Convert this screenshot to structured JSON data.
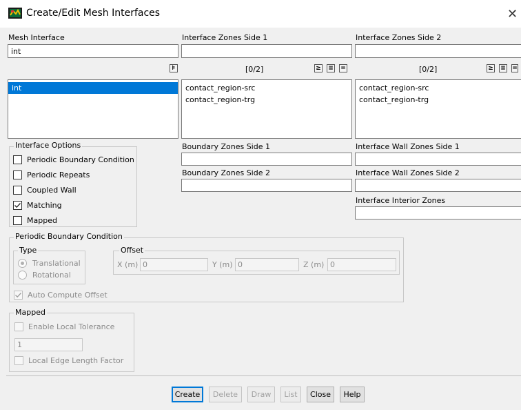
{
  "window": {
    "title": "Create/Edit Mesh Interfaces",
    "close_glyph": "✕"
  },
  "mesh_interface": {
    "label": "Mesh Interface",
    "value": "int",
    "items": [
      {
        "label": "int",
        "selected": true
      }
    ]
  },
  "zones_side1": {
    "label": "Interface Zones Side 1",
    "count": "[0/2]",
    "items": [
      "contact_region-src",
      "contact_region-trg"
    ]
  },
  "zones_side2": {
    "label": "Interface Zones Side 2",
    "count": "[0/2]",
    "items": [
      "contact_region-src",
      "contact_region-trg"
    ]
  },
  "interface_options": {
    "title": "Interface Options",
    "items": [
      {
        "label": "Periodic Boundary Condition",
        "checked": false
      },
      {
        "label": "Periodic Repeats",
        "checked": false
      },
      {
        "label": "Coupled Wall",
        "checked": false
      },
      {
        "label": "Matching",
        "checked": true
      },
      {
        "label": "Mapped",
        "checked": false
      }
    ]
  },
  "boundary_zones": {
    "side1_label": "Boundary Zones Side 1",
    "side2_label": "Boundary Zones Side 2"
  },
  "interface_wall_zones": {
    "side1_label": "Interface Wall Zones Side 1",
    "side2_label": "Interface Wall Zones Side 2",
    "interior_label": "Interface Interior Zones"
  },
  "periodic_bc": {
    "title": "Periodic Boundary Condition",
    "type_title": "Type",
    "translational": "Translational",
    "rotational": "Rotational",
    "offset_title": "Offset",
    "x_label": "X (m)",
    "x_value": "0",
    "y_label": "Y (m)",
    "y_value": "0",
    "z_label": "Z (m)",
    "z_value": "0",
    "auto_compute": "Auto Compute Offset",
    "auto_compute_checked": true
  },
  "mapped": {
    "title": "Mapped",
    "enable_local_tolerance": "Enable Local Tolerance",
    "tolerance_value": "1",
    "local_edge_length_factor": "Local Edge Length Factor"
  },
  "buttons": {
    "create": "Create",
    "delete": "Delete",
    "draw": "Draw",
    "list": "List",
    "close": "Close",
    "help": "Help"
  },
  "colors": {
    "accent": "#0078d7",
    "background": "#f0f0f0"
  },
  "icons": {
    "app": "ansys-fluent-icon",
    "list_tools": [
      "select-all-icon",
      "select-none-icon",
      "filter-icon"
    ]
  }
}
